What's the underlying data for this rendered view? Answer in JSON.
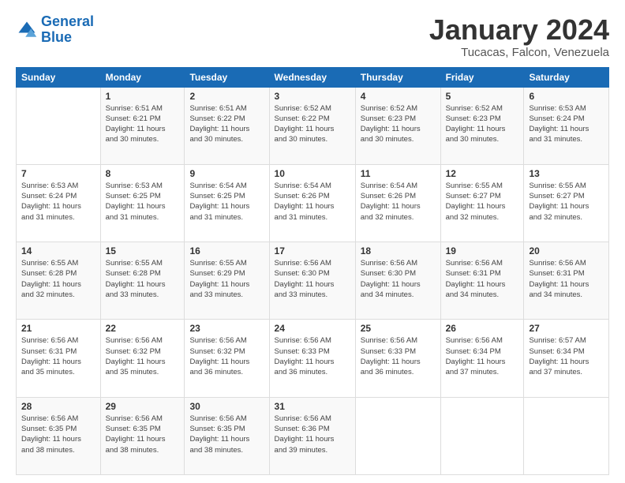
{
  "logo": {
    "line1": "General",
    "line2": "Blue"
  },
  "title": "January 2024",
  "location": "Tucacas, Falcon, Venezuela",
  "headers": [
    "Sunday",
    "Monday",
    "Tuesday",
    "Wednesday",
    "Thursday",
    "Friday",
    "Saturday"
  ],
  "weeks": [
    [
      {
        "day": "",
        "info": ""
      },
      {
        "day": "1",
        "info": "Sunrise: 6:51 AM\nSunset: 6:21 PM\nDaylight: 11 hours\nand 30 minutes."
      },
      {
        "day": "2",
        "info": "Sunrise: 6:51 AM\nSunset: 6:22 PM\nDaylight: 11 hours\nand 30 minutes."
      },
      {
        "day": "3",
        "info": "Sunrise: 6:52 AM\nSunset: 6:22 PM\nDaylight: 11 hours\nand 30 minutes."
      },
      {
        "day": "4",
        "info": "Sunrise: 6:52 AM\nSunset: 6:23 PM\nDaylight: 11 hours\nand 30 minutes."
      },
      {
        "day": "5",
        "info": "Sunrise: 6:52 AM\nSunset: 6:23 PM\nDaylight: 11 hours\nand 30 minutes."
      },
      {
        "day": "6",
        "info": "Sunrise: 6:53 AM\nSunset: 6:24 PM\nDaylight: 11 hours\nand 31 minutes."
      }
    ],
    [
      {
        "day": "7",
        "info": "Sunrise: 6:53 AM\nSunset: 6:24 PM\nDaylight: 11 hours\nand 31 minutes."
      },
      {
        "day": "8",
        "info": "Sunrise: 6:53 AM\nSunset: 6:25 PM\nDaylight: 11 hours\nand 31 minutes."
      },
      {
        "day": "9",
        "info": "Sunrise: 6:54 AM\nSunset: 6:25 PM\nDaylight: 11 hours\nand 31 minutes."
      },
      {
        "day": "10",
        "info": "Sunrise: 6:54 AM\nSunset: 6:26 PM\nDaylight: 11 hours\nand 31 minutes."
      },
      {
        "day": "11",
        "info": "Sunrise: 6:54 AM\nSunset: 6:26 PM\nDaylight: 11 hours\nand 32 minutes."
      },
      {
        "day": "12",
        "info": "Sunrise: 6:55 AM\nSunset: 6:27 PM\nDaylight: 11 hours\nand 32 minutes."
      },
      {
        "day": "13",
        "info": "Sunrise: 6:55 AM\nSunset: 6:27 PM\nDaylight: 11 hours\nand 32 minutes."
      }
    ],
    [
      {
        "day": "14",
        "info": "Sunrise: 6:55 AM\nSunset: 6:28 PM\nDaylight: 11 hours\nand 32 minutes."
      },
      {
        "day": "15",
        "info": "Sunrise: 6:55 AM\nSunset: 6:28 PM\nDaylight: 11 hours\nand 33 minutes."
      },
      {
        "day": "16",
        "info": "Sunrise: 6:55 AM\nSunset: 6:29 PM\nDaylight: 11 hours\nand 33 minutes."
      },
      {
        "day": "17",
        "info": "Sunrise: 6:56 AM\nSunset: 6:30 PM\nDaylight: 11 hours\nand 33 minutes."
      },
      {
        "day": "18",
        "info": "Sunrise: 6:56 AM\nSunset: 6:30 PM\nDaylight: 11 hours\nand 34 minutes."
      },
      {
        "day": "19",
        "info": "Sunrise: 6:56 AM\nSunset: 6:31 PM\nDaylight: 11 hours\nand 34 minutes."
      },
      {
        "day": "20",
        "info": "Sunrise: 6:56 AM\nSunset: 6:31 PM\nDaylight: 11 hours\nand 34 minutes."
      }
    ],
    [
      {
        "day": "21",
        "info": "Sunrise: 6:56 AM\nSunset: 6:31 PM\nDaylight: 11 hours\nand 35 minutes."
      },
      {
        "day": "22",
        "info": "Sunrise: 6:56 AM\nSunset: 6:32 PM\nDaylight: 11 hours\nand 35 minutes."
      },
      {
        "day": "23",
        "info": "Sunrise: 6:56 AM\nSunset: 6:32 PM\nDaylight: 11 hours\nand 36 minutes."
      },
      {
        "day": "24",
        "info": "Sunrise: 6:56 AM\nSunset: 6:33 PM\nDaylight: 11 hours\nand 36 minutes."
      },
      {
        "day": "25",
        "info": "Sunrise: 6:56 AM\nSunset: 6:33 PM\nDaylight: 11 hours\nand 36 minutes."
      },
      {
        "day": "26",
        "info": "Sunrise: 6:56 AM\nSunset: 6:34 PM\nDaylight: 11 hours\nand 37 minutes."
      },
      {
        "day": "27",
        "info": "Sunrise: 6:57 AM\nSunset: 6:34 PM\nDaylight: 11 hours\nand 37 minutes."
      }
    ],
    [
      {
        "day": "28",
        "info": "Sunrise: 6:56 AM\nSunset: 6:35 PM\nDaylight: 11 hours\nand 38 minutes."
      },
      {
        "day": "29",
        "info": "Sunrise: 6:56 AM\nSunset: 6:35 PM\nDaylight: 11 hours\nand 38 minutes."
      },
      {
        "day": "30",
        "info": "Sunrise: 6:56 AM\nSunset: 6:35 PM\nDaylight: 11 hours\nand 38 minutes."
      },
      {
        "day": "31",
        "info": "Sunrise: 6:56 AM\nSunset: 6:36 PM\nDaylight: 11 hours\nand 39 minutes."
      },
      {
        "day": "",
        "info": ""
      },
      {
        "day": "",
        "info": ""
      },
      {
        "day": "",
        "info": ""
      }
    ]
  ]
}
